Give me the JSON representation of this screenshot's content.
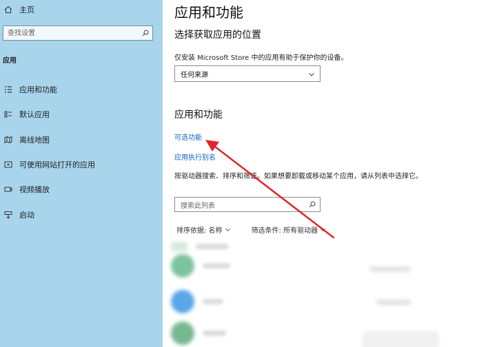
{
  "sidebar": {
    "home_label": "主页",
    "search_placeholder": "查找设置",
    "section_title": "应用",
    "items": [
      {
        "label": "应用和功能",
        "icon": "list-icon"
      },
      {
        "label": "默认应用",
        "icon": "default-apps-icon"
      },
      {
        "label": "离线地图",
        "icon": "map-icon"
      },
      {
        "label": "可使用网站打开的应用",
        "icon": "web-app-icon"
      },
      {
        "label": "视频播放",
        "icon": "video-icon"
      },
      {
        "label": "启动",
        "icon": "startup-icon"
      }
    ]
  },
  "main": {
    "title": "应用和功能",
    "location_heading": "选择获取应用的位置",
    "location_desc": "仅安装 Microsoft Store 中的应用有助于保护你的设备。",
    "location_dropdown_value": "任何来源",
    "apps_heading": "应用和功能",
    "optional_features_link": "可选功能",
    "app_alias_link": "应用执行别名",
    "info_text": "按驱动器搜索、排序和筛选。如果想要卸载或移动某个应用，请从列表中选择它。",
    "list_search_placeholder": "搜索此列表",
    "sort_label": "排序依据: 名称",
    "filter_label": "筛选条件: 所有驱动器"
  },
  "colors": {
    "sidebar_bg": "#a8d4ec",
    "link": "#0a62c8",
    "annotation_arrow": "#e0262b"
  }
}
